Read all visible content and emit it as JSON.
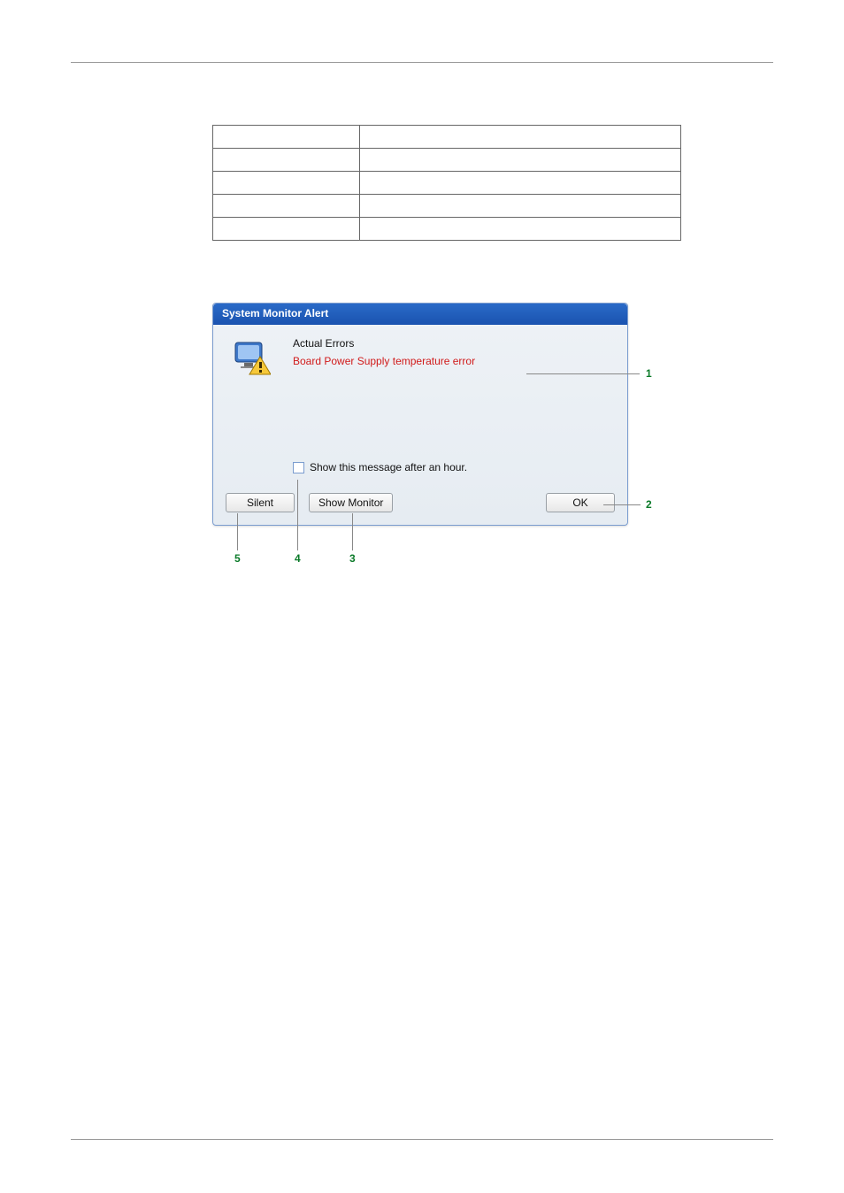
{
  "table": {
    "rows": [
      {
        "col1": "",
        "col2": ""
      },
      {
        "col1": "",
        "col2": ""
      },
      {
        "col1": "",
        "col2": ""
      },
      {
        "col1": "",
        "col2": ""
      },
      {
        "col1": "",
        "col2": ""
      }
    ]
  },
  "dialog": {
    "title": "System Monitor Alert",
    "section_label": "Actual Errors",
    "error_message": "Board Power Supply temperature error",
    "checkbox_label": "Show this message after an hour.",
    "buttons": {
      "silent": "Silent",
      "show_monitor": "Show Monitor",
      "ok": "OK"
    },
    "icon_name": "monitor-alert-icon"
  },
  "callouts": {
    "n1": "1",
    "n2": "2",
    "n3": "3",
    "n4": "4",
    "n5": "5"
  }
}
